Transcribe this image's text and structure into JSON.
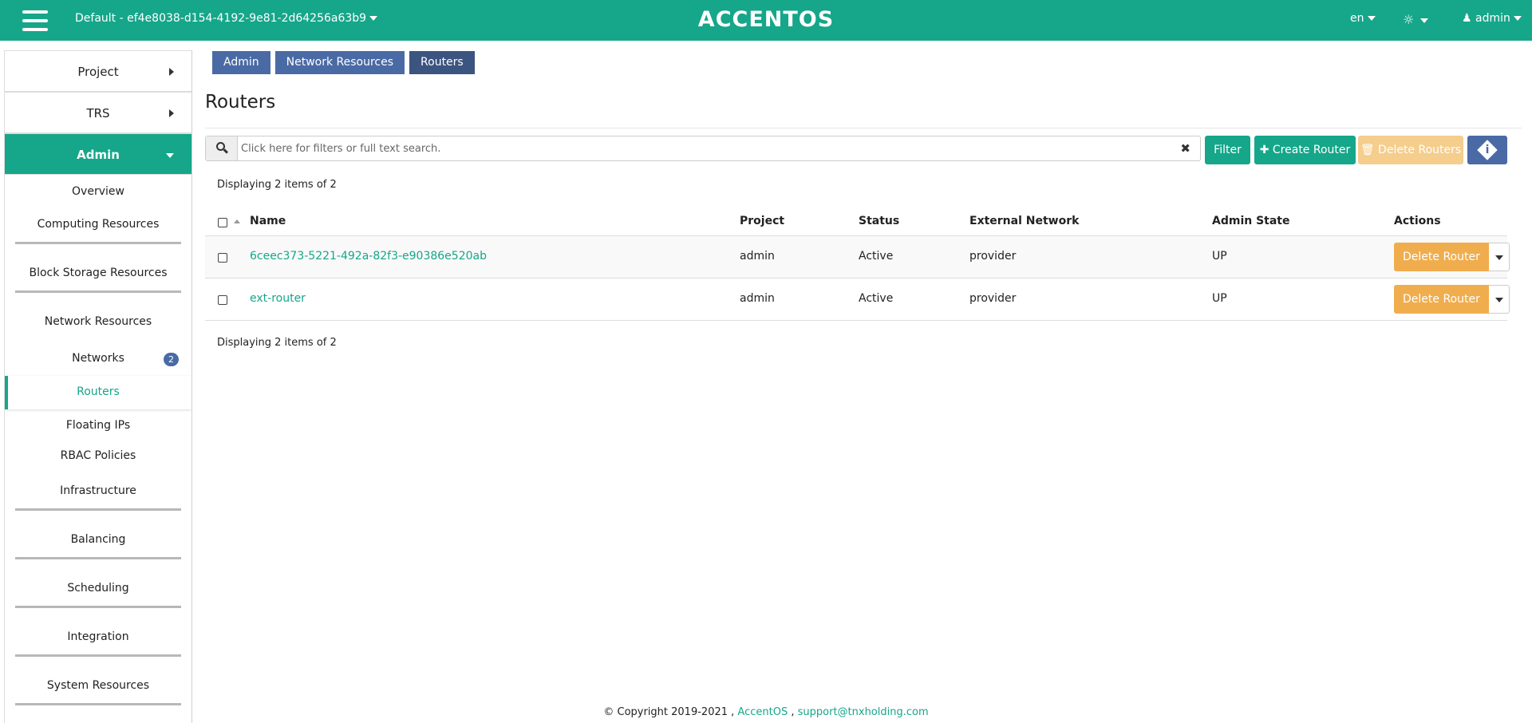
{
  "header": {
    "project": "Default - ef4e8038-d154-4192-9e81-2d64256a63b9",
    "brand": "ACCENTOS",
    "lang": "en",
    "user": "admin"
  },
  "sidebar": {
    "top": [
      {
        "label": "Project"
      },
      {
        "label": "TRS"
      },
      {
        "label": "Admin"
      }
    ],
    "admin_items": {
      "overview": "Overview",
      "computing": "Computing Resources",
      "block_storage": "Block Storage Resources",
      "network": "Network Resources",
      "networks": "Networks",
      "networks_badge": "2",
      "routers": "Routers",
      "floating_ips": "Floating IPs",
      "rbac": "RBAC Policies",
      "infrastructure": "Infrastructure",
      "balancing": "Balancing",
      "scheduling": "Scheduling",
      "integration": "Integration",
      "system": "System Resources"
    }
  },
  "breadcrumb": [
    "Admin",
    "Network Resources",
    "Routers"
  ],
  "page": {
    "title": "Routers",
    "search_placeholder": "Click here for filters or full text search.",
    "filter_label": "Filter",
    "create_label": "Create Router",
    "delete_all_label": "Delete Routers",
    "count_text": "Displaying 2 items of 2"
  },
  "table": {
    "headers": {
      "name": "Name",
      "project": "Project",
      "status": "Status",
      "external_network": "External Network",
      "admin_state": "Admin State",
      "actions": "Actions"
    },
    "rows": [
      {
        "name": "6ceec373-5221-492a-82f3-e90386e520ab",
        "project": "admin",
        "status": "Active",
        "external_network": "provider",
        "admin_state": "UP",
        "action": "Delete Router"
      },
      {
        "name": "ext-router",
        "project": "admin",
        "status": "Active",
        "external_network": "provider",
        "admin_state": "UP",
        "action": "Delete Router"
      }
    ]
  },
  "footer": {
    "copyright": "© Copyright 2019-2021 ,",
    "product": "AccentOS",
    "sep": ",",
    "email": "support@tnxholding.com"
  },
  "colors": {
    "primary": "#16a68a",
    "breadcrumb": "#4a6aa5",
    "warning": "#f0ad4e"
  }
}
